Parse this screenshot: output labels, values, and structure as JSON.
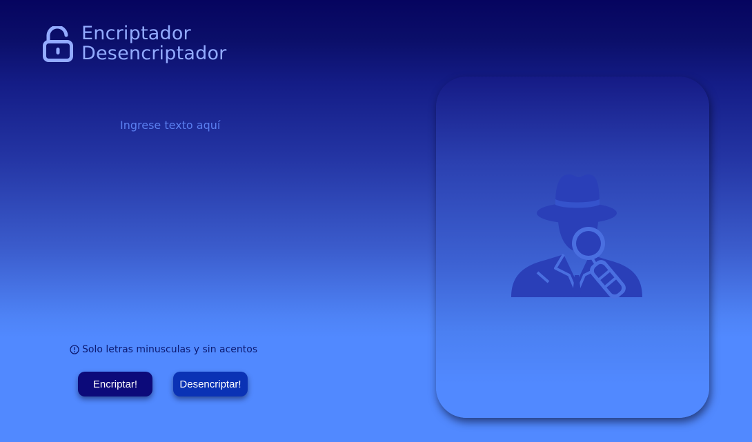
{
  "brand": {
    "title_line1": "Encriptador",
    "title_line2": "Desencriptador",
    "icon": "unlocked-padlock-icon"
  },
  "input": {
    "placeholder": "Ingrese texto aquí",
    "value": ""
  },
  "hint": {
    "icon": "info-circle-icon",
    "text": "Solo letras minusculas y sin acentos"
  },
  "buttons": {
    "encrypt_label": "Encriptar!",
    "decrypt_label": "Desencriptar!"
  },
  "output": {
    "icon": "detective-icon"
  },
  "colors": {
    "brand_text": "#93abff",
    "encrypt_button": "#0c0a7a",
    "decrypt_button": "#0a32b5",
    "background_top": "#06045f",
    "background_bottom": "#5189ff",
    "detective_fill": "#2a3fb8"
  }
}
